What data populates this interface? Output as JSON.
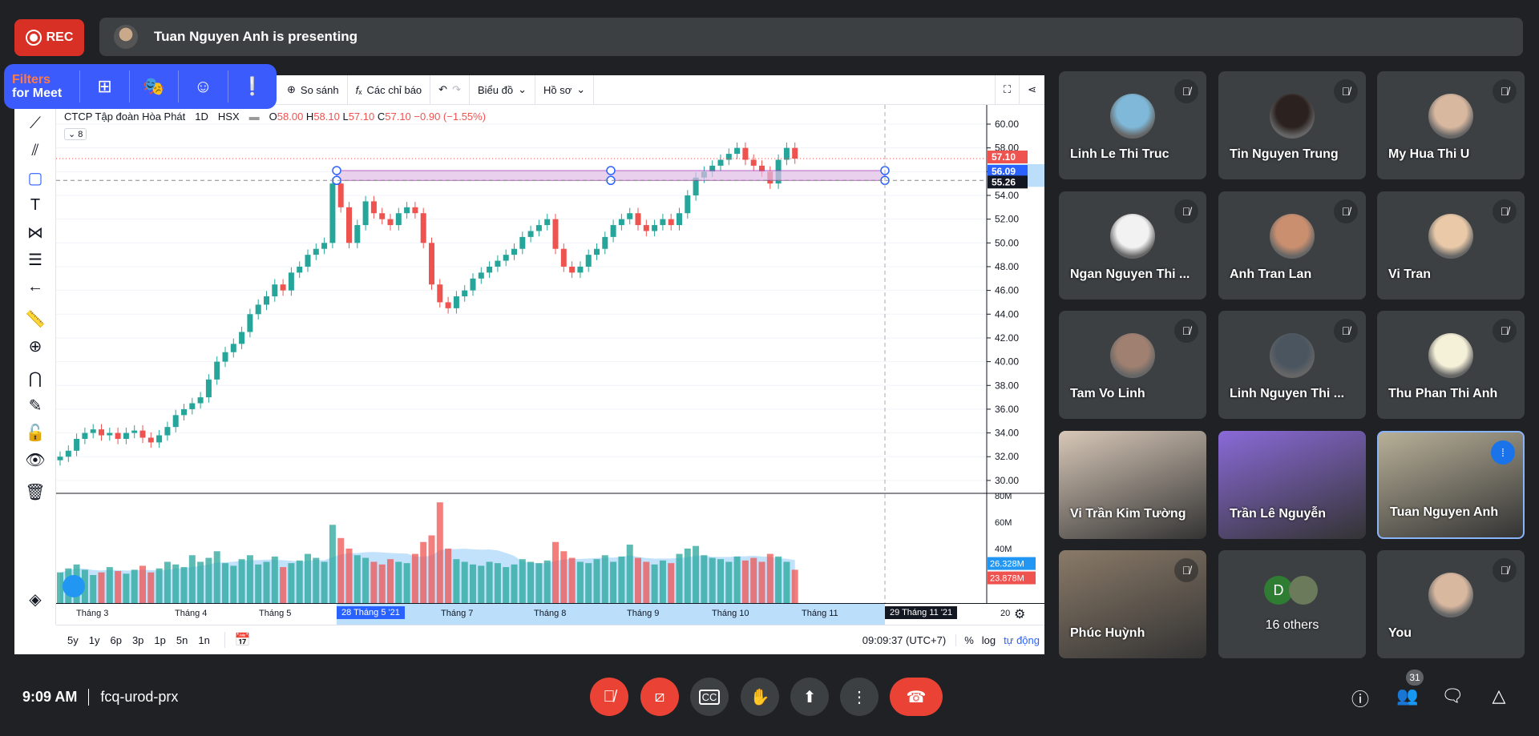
{
  "recording": {
    "label": "REC"
  },
  "presenter": {
    "text": "Tuan Nguyen Anh is presenting"
  },
  "filters": {
    "line1": "Filters",
    "line2": "for Meet",
    "icons": [
      "add-filter-icon",
      "masks-icon",
      "face-icon",
      "feedback-icon"
    ]
  },
  "toolbar": {
    "compare": "So sánh",
    "indicators": "Các chỉ báo",
    "chart": "Biểu đồ",
    "profile": "Hồ sơ"
  },
  "legend": {
    "symbol": "CTCP Tập đoàn Hòa Phát",
    "interval": "1D",
    "exchange": "HSX",
    "o": "58.00",
    "h": "58.10",
    "l": "57.10",
    "c": "57.10",
    "change": "−0.90 (−1.55%)",
    "indicator_count": "8"
  },
  "price_labels": {
    "last": "57.10",
    "rect_top": "56.09",
    "cursor": "55.26",
    "vol_ma": "26.328M",
    "vol": "23.878M"
  },
  "ranges": [
    "5y",
    "1y",
    "6p",
    "3p",
    "1p",
    "5n",
    "1n"
  ],
  "status": {
    "time": "09:09:37 (UTC+7)",
    "percent": "%",
    "log": "log",
    "auto": "tự động"
  },
  "colors": {
    "up": "#26a69a",
    "down": "#ef5350",
    "accent": "#2962ff",
    "rect": "#e1bee7"
  },
  "chart_data": {
    "type": "candlestick",
    "y_ticks": [
      "60.00",
      "58.00",
      "56.00",
      "54.00",
      "52.00",
      "50.00",
      "48.00",
      "46.00",
      "44.00",
      "42.00",
      "40.00",
      "38.00",
      "36.00",
      "34.00",
      "32.00",
      "30.00"
    ],
    "ylim": [
      29,
      61
    ],
    "vol_ticks": [
      "80M",
      "60M",
      "40M",
      "20M"
    ],
    "x_ticks": [
      "Tháng 3",
      "Tháng 4",
      "Tháng 5",
      "28 Tháng 5 '21",
      "Tháng 7",
      "Tháng 8",
      "Tháng 9",
      "Tháng 10",
      "Tháng 11",
      "29 Tháng 11 '21",
      "20"
    ],
    "close": [
      32.0,
      32.5,
      33.5,
      34.0,
      34.3,
      33.8,
      34.0,
      33.5,
      34.0,
      34.2,
      33.6,
      33.2,
      33.8,
      34.5,
      35.5,
      36.0,
      36.5,
      37.0,
      38.5,
      40.0,
      40.8,
      41.5,
      42.5,
      44.0,
      44.8,
      45.5,
      46.5,
      46.0,
      47.5,
      48.0,
      49.0,
      49.5,
      50.0,
      55.0,
      53.0,
      50.0,
      51.5,
      53.5,
      52.5,
      52.0,
      51.5,
      52.5,
      53.0,
      52.5,
      50.0,
      46.5,
      45.0,
      44.5,
      45.5,
      46.0,
      47.0,
      47.5,
      48.0,
      48.5,
      49.0,
      49.5,
      50.5,
      51.0,
      51.5,
      52.0,
      49.5,
      48.0,
      47.5,
      48.0,
      49.0,
      49.5,
      50.5,
      51.5,
      52.0,
      52.5,
      51.5,
      51.0,
      51.5,
      52.0,
      51.5,
      52.5,
      54.0,
      55.5,
      56.0,
      56.5,
      57.0,
      57.5,
      58.0,
      57.0,
      56.5,
      56.0,
      55.0,
      57.0,
      58.0,
      57.1
    ],
    "volume_m": [
      22,
      25,
      28,
      24,
      20,
      22,
      26,
      23,
      21,
      24,
      27,
      22,
      25,
      30,
      28,
      26,
      35,
      30,
      33,
      38,
      29,
      27,
      32,
      35,
      28,
      30,
      34,
      26,
      29,
      31,
      36,
      33,
      30,
      58,
      48,
      40,
      35,
      33,
      30,
      28,
      32,
      30,
      29,
      36,
      45,
      50,
      75,
      40,
      32,
      30,
      28,
      27,
      30,
      29,
      26,
      28,
      32,
      30,
      29,
      31,
      45,
      38,
      33,
      30,
      29,
      32,
      35,
      30,
      34,
      43,
      33,
      30,
      28,
      31,
      29,
      36,
      40,
      42,
      35,
      33,
      32,
      30,
      34,
      31,
      33,
      30,
      36,
      34,
      30,
      24
    ],
    "rectangle": {
      "from": "28 Tháng 5 '21",
      "to": "29 Tháng 11 '21",
      "top": 56.09,
      "bottom": 55.26
    }
  },
  "participants": [
    {
      "name": "Linh Le Thi Truc",
      "muted": true,
      "avatar": "#7fb8d8"
    },
    {
      "name": "Tin Nguyen Trung",
      "muted": true,
      "avatar": "#2b2220"
    },
    {
      "name": "My Hua Thi U",
      "muted": true,
      "avatar": "#d9b8a0"
    },
    {
      "name": "Ngan Nguyen Thi ...",
      "muted": true,
      "avatar": "#f2f2f2"
    },
    {
      "name": "Anh Tran Lan",
      "muted": true,
      "avatar": "#c98f6f"
    },
    {
      "name": "Vi Tran",
      "muted": true,
      "avatar": "#e9c9a8"
    },
    {
      "name": "Tam Vo Linh",
      "muted": true,
      "avatar": "#a08070"
    },
    {
      "name": "Linh Nguyen Thi ...",
      "muted": true,
      "avatar": "#4a5560"
    },
    {
      "name": "Thu Phan Thi Anh",
      "muted": true,
      "avatar": "#f5f0d8"
    },
    {
      "name": "Vi Trần Kim Tường",
      "muted": false,
      "video": "#d8c8b8"
    },
    {
      "name": "Trần Lê Nguyễn",
      "muted": false,
      "video": "#8a6ad8"
    },
    {
      "name": "Tuan Nguyen Anh",
      "muted": false,
      "video": "#b8b098",
      "speaking": true
    },
    {
      "name": "Phúc Huỳnh",
      "muted": true,
      "video": "#8a7a68"
    },
    {
      "name": "16 others",
      "muted": false,
      "others": true,
      "initial": "D"
    },
    {
      "name": "You",
      "muted": true,
      "avatar": "#d9b8a0"
    }
  ],
  "meeting": {
    "time": "9:09 AM",
    "code": "fcq-urod-prx",
    "participant_count": "31"
  }
}
